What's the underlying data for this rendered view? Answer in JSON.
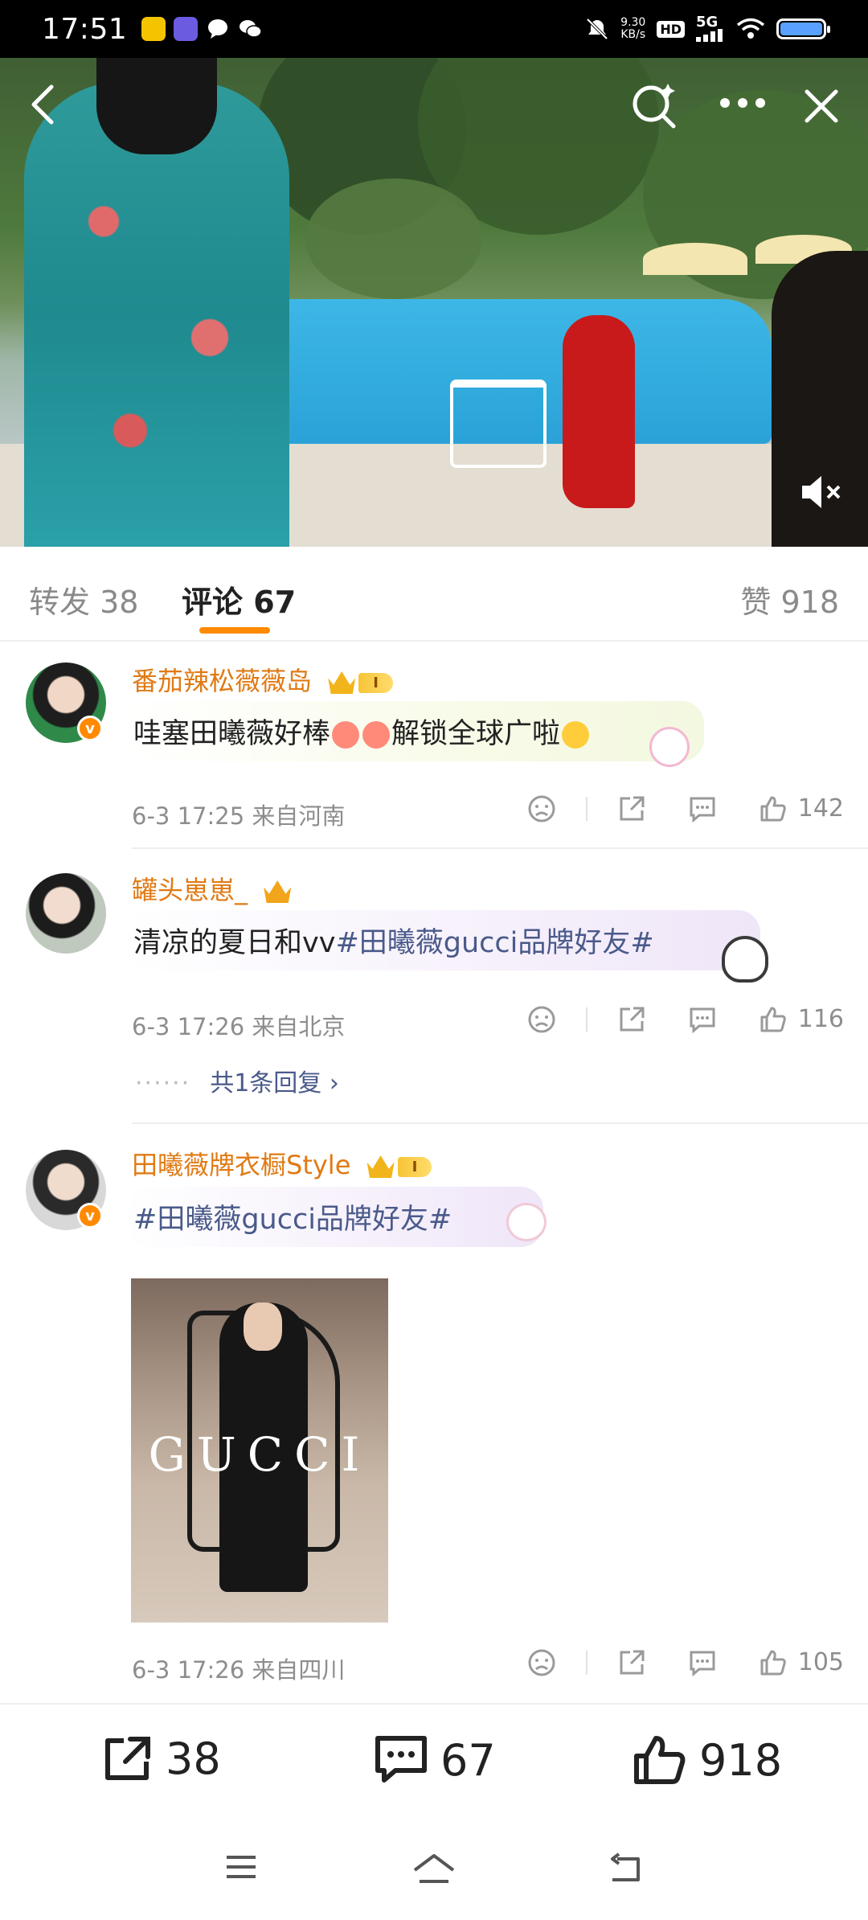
{
  "status_bar": {
    "time": "17:51",
    "net_speed_value": "9.30",
    "net_speed_unit": "KB/s",
    "hd": "HD",
    "network": "5G"
  },
  "tabs": {
    "repost_label": "转发",
    "repost_count": "38",
    "comment_label": "评论",
    "comment_count": "67",
    "like_label": "赞",
    "like_count": "918"
  },
  "comments": [
    {
      "username": "番茄辣松薇薇岛",
      "level": "I",
      "text_before": "哇塞田曦薇好棒",
      "text_after": "解锁全球广啦",
      "time_location": "6-3 17:25  来自河南",
      "likes": "142"
    },
    {
      "username": "罐头崽崽_",
      "text_plain": "清凉的夏日和vv",
      "hashtag": "#田曦薇gucci品牌好友#",
      "time_location": "6-3 17:26  来自北京",
      "likes": "116",
      "reply_link": "共1条回复 ›",
      "reply_dots": "······"
    },
    {
      "username": "田曦薇牌衣橱Style",
      "level": "I",
      "hashtag": "#田曦薇gucci品牌好友#",
      "image_logo": "GUCCI",
      "time_location": "6-3 17:26  来自四川",
      "likes": "105"
    }
  ],
  "bottom_bar": {
    "repost_count": "38",
    "comment_count": "67",
    "like_count": "918"
  },
  "colors": {
    "accent": "#ff8a00",
    "username": "#e07a14",
    "hashtag": "#4a5a8a"
  }
}
